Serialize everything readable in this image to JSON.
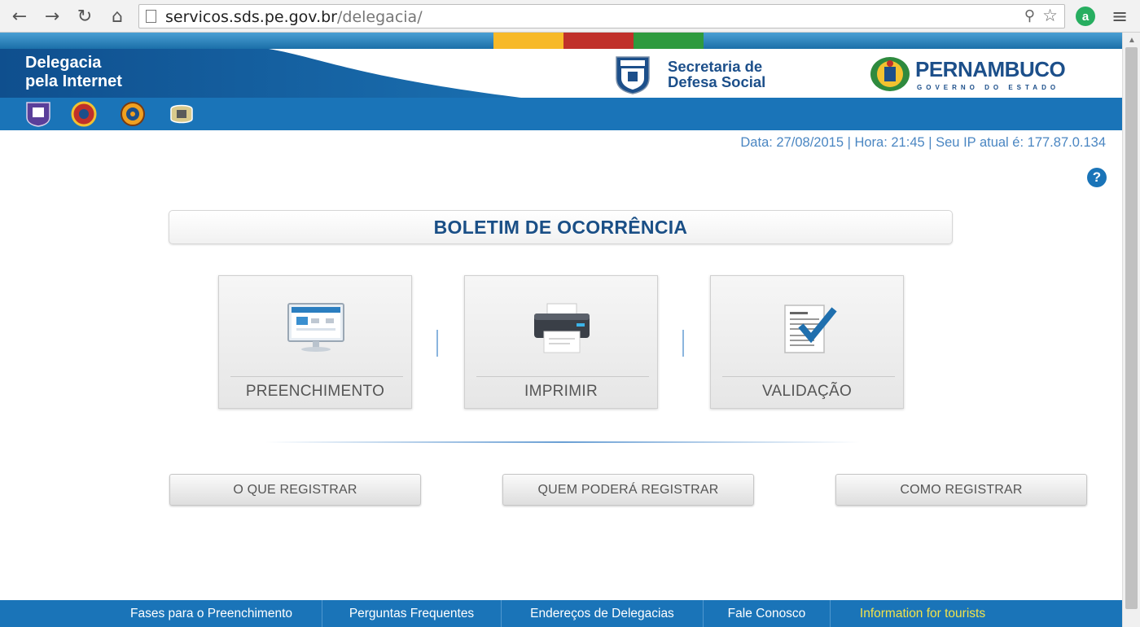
{
  "browser": {
    "url_host": "servicos.sds.pe.gov.br",
    "url_path": "/delegacia/",
    "ext_icon_letter": "a"
  },
  "header": {
    "app_title_line1": "Delegacia",
    "app_title_line2": "pela Internet",
    "sds_line1": "Secretaria de",
    "sds_line2": "Defesa Social",
    "state_name": "PERNAMBUCO",
    "state_sub": "GOVERNO DO ESTADO",
    "strip_colors": [
      "#f7b928",
      "#c0302a",
      "#2e9a3e"
    ],
    "badges": [
      "policia-civil-badge-icon",
      "bombeiros-badge-icon",
      "pericia-badge-icon",
      "policia-militar-badge-icon"
    ]
  },
  "info": {
    "text": "Data: 27/08/2015 | Hora: 21:45 | Seu IP atual é: 177.87.0.134",
    "help_glyph": "?"
  },
  "main": {
    "title": "BOLETIM DE OCORRÊNCIA",
    "cards": [
      {
        "label": "PREENCHIMENTO",
        "icon": "monitor-icon"
      },
      {
        "label": "IMPRIMIR",
        "icon": "printer-icon"
      },
      {
        "label": "VALIDAÇÃO",
        "icon": "document-check-icon"
      }
    ],
    "buttons": [
      {
        "label": "O QUE REGISTRAR"
      },
      {
        "label": "QUEM PODERÁ REGISTRAR"
      },
      {
        "label": "COMO REGISTRAR"
      }
    ]
  },
  "footer": {
    "items": [
      {
        "label": "Fases para o Preenchimento"
      },
      {
        "label": "Perguntas Frequentes"
      },
      {
        "label": "Endereços de Delegacias"
      },
      {
        "label": "Fale Conosco"
      },
      {
        "label": "Information for tourists"
      }
    ]
  },
  "colors": {
    "brand_blue": "#1a74b8",
    "dark_blue": "#1a4f86",
    "footer_highlight": "#f2e34a"
  }
}
